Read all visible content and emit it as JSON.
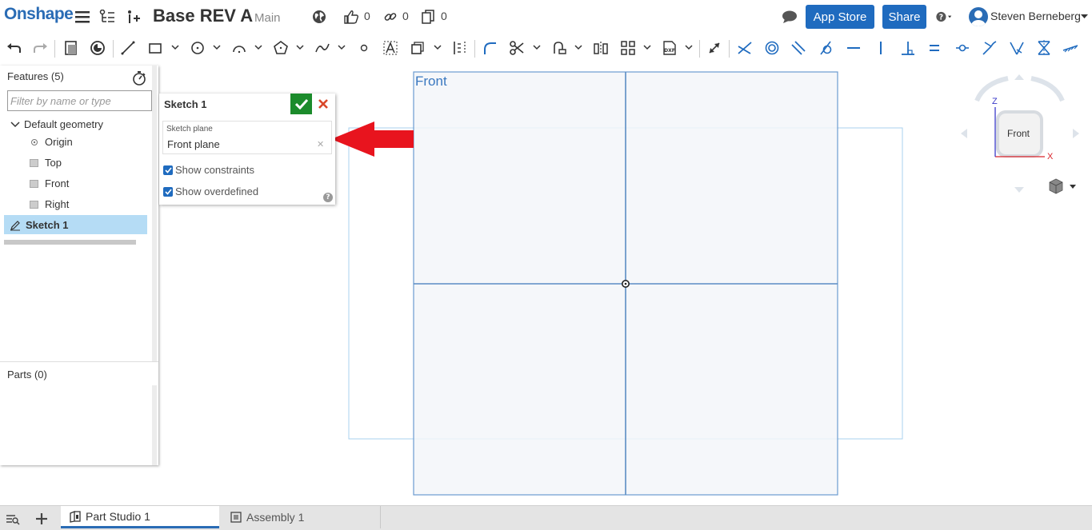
{
  "header": {
    "logo": "Onshape",
    "document_title": "Base REV A",
    "branch": "Main",
    "likes_count": "0",
    "links_count": "0",
    "copies_count": "0",
    "app_store_label": "App Store",
    "share_label": "Share",
    "user_name": "Steven Berneberg"
  },
  "feature_panel": {
    "title": "Features (5)",
    "filter_placeholder": "Filter by name or type",
    "default_geometry_label": "Default geometry",
    "items": [
      {
        "label": "Origin"
      },
      {
        "label": "Top"
      },
      {
        "label": "Front"
      },
      {
        "label": "Right"
      }
    ],
    "selected_feature": "Sketch 1",
    "parts_title": "Parts (0)"
  },
  "sketch_dialog": {
    "title": "Sketch 1",
    "plane_label": "Sketch plane",
    "plane_value": "Front plane",
    "show_constraints_label": "Show constraints",
    "show_overdefined_label": "Show overdefined",
    "show_constraints_checked": true,
    "show_overdefined_checked": true
  },
  "viewport": {
    "plane_name": "Front",
    "view_cube_face": "Front",
    "axis_z": "Z",
    "axis_x": "X"
  },
  "tabs": [
    {
      "label": "Part Studio 1",
      "active": true
    },
    {
      "label": "Assembly 1",
      "active": false
    }
  ],
  "colors": {
    "brand_blue": "#2a6cb5",
    "button_blue": "#1f6bbf",
    "accept_green": "#1b8b2b",
    "cancel_red": "#d9482b",
    "annotation_arrow_red": "#e8141e",
    "selection_bg": "#b5dcf5",
    "plane_fill": "#f3f6f9",
    "plane_stroke": "#6b9bd0"
  }
}
